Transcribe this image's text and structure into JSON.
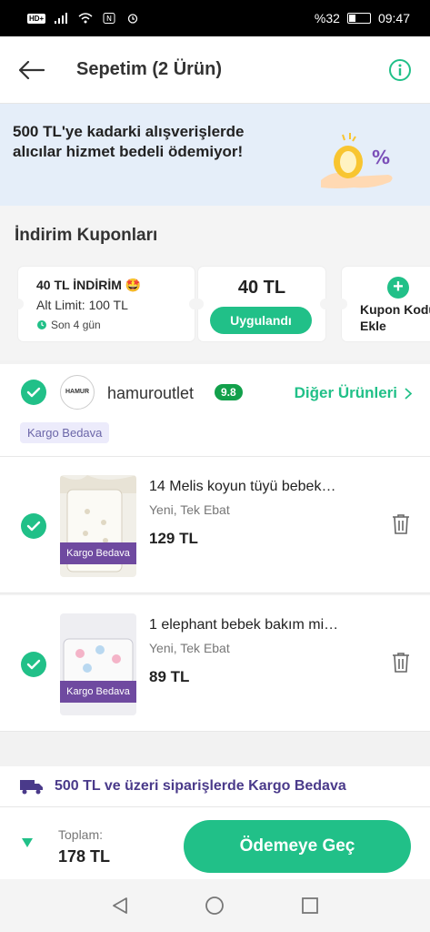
{
  "statusbar": {
    "battery": "%32",
    "time": "09:47"
  },
  "header": {
    "title": "Sepetim (2 Ürün)"
  },
  "banner": {
    "text": "500 TL'ye kadarki alışverişlerde alıcılar hizmet bedeli ödemiyor!"
  },
  "coupons": {
    "title": "İndirim Kuponları",
    "card1": {
      "line1": "40 TL İNDİRİM 🤩",
      "line2": "Alt Limit: 100 TL",
      "line3": "Son 4 gün"
    },
    "card2": {
      "amount": "40 TL",
      "button": "Uygulandı"
    },
    "card3": {
      "label": "Kupon Kodu Ekle"
    }
  },
  "store": {
    "logo_text": "HAMUR",
    "name": "hamuroutlet",
    "rating": "9.8",
    "other_link": "Diğer Ürünleri",
    "tag": "Kargo Bedava"
  },
  "products": [
    {
      "title": "14 Melis koyun tüyü bebek…",
      "variant": "Yeni, Tek Ebat",
      "price": "129 TL",
      "tag": "Kargo Bedava"
    },
    {
      "title": "1 elephant bebek bakım mi…",
      "variant": "Yeni, Tek Ebat",
      "price": "89 TL",
      "tag": "Kargo Bedava"
    }
  ],
  "shipping": {
    "text": "500 TL ve üzeri siparişlerde Kargo Bedava"
  },
  "footer": {
    "total_label": "Toplam:",
    "total_value": "178 TL",
    "pay_button": "Ödemeye Geç"
  },
  "colors": {
    "accent": "#21c088",
    "purple": "#6f4aa0",
    "banner_bg": "#e5eef9"
  },
  "icons": [
    "back-arrow-icon",
    "info-icon",
    "check-icon",
    "trash-icon",
    "truck-icon",
    "plus-icon",
    "nav-back-icon",
    "nav-home-icon",
    "nav-recent-icon"
  ]
}
